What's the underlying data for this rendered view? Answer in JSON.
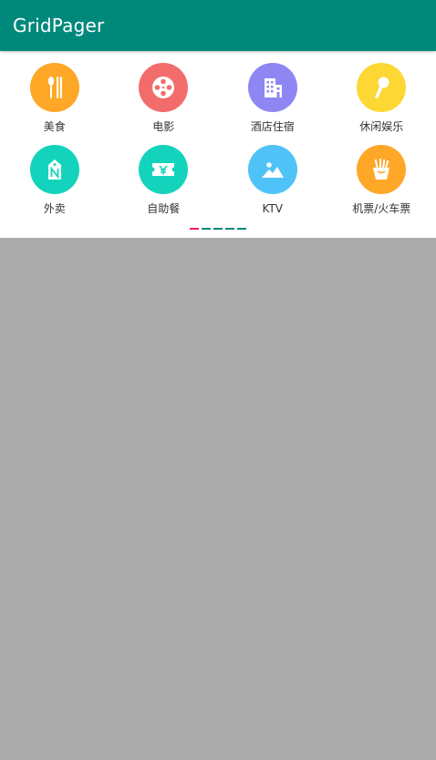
{
  "app": {
    "title": "GridPager"
  },
  "colors": {
    "appbar": "#00897b",
    "page_bg": "#ababab",
    "panel_bg": "#ffffff",
    "indicator_active": "#e91e63",
    "indicator_inactive": "#00897b"
  },
  "grid": {
    "items": [
      {
        "label": "美食",
        "icon": "food-icon",
        "color": "#ffa726"
      },
      {
        "label": "电影",
        "icon": "film-reel-icon",
        "color": "#f36c6c"
      },
      {
        "label": "酒店住宿",
        "icon": "hotel-building-icon",
        "color": "#8d86f3"
      },
      {
        "label": "休闲娱乐",
        "icon": "microphone-icon",
        "color": "#fdd835"
      },
      {
        "label": "外卖",
        "icon": "tag-icon",
        "color": "#14d3bc"
      },
      {
        "label": "自助餐",
        "icon": "coupon-icon",
        "color": "#14d3bc"
      },
      {
        "label": "KTV",
        "icon": "image-icon",
        "color": "#4fc3f7"
      },
      {
        "label": "机票/火车票",
        "icon": "fries-icon",
        "color": "#ffa726"
      }
    ]
  },
  "pager": {
    "page_count": 5,
    "current_page": 1
  }
}
